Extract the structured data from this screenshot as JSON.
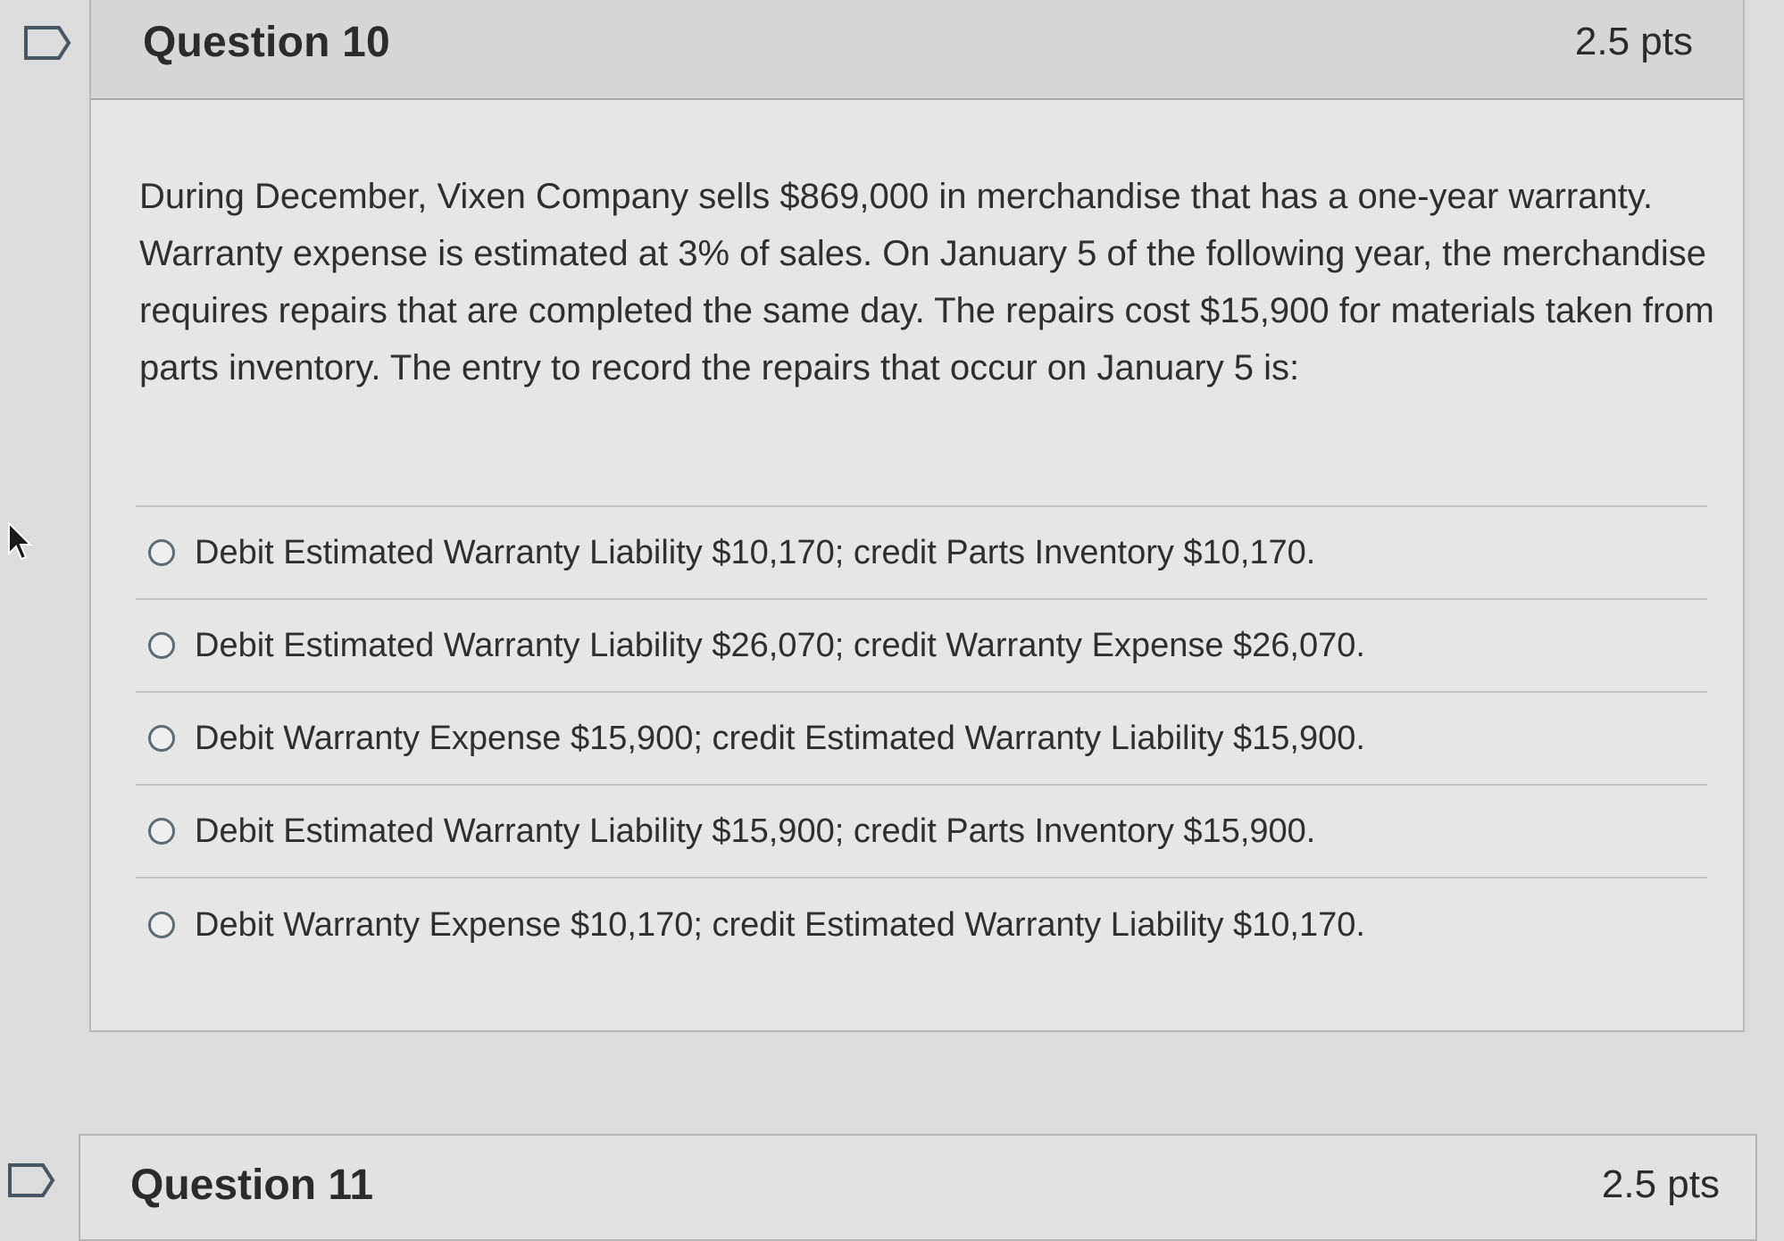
{
  "question": {
    "title": "Question 10",
    "points": "2.5 pts",
    "text": "During December, Vixen Company sells $869,000 in merchandise that has a one-year warranty. Warranty expense is estimated at 3% of sales. On January 5 of the following year, the merchandise requires repairs that are completed the same day. The repairs cost $15,900 for materials taken from parts inventory. The entry to record the repairs that occur on January 5 is:",
    "answers": [
      {
        "label": "Debit Estimated Warranty Liability $10,170; credit Parts Inventory $10,170."
      },
      {
        "label": "Debit Estimated Warranty Liability $26,070; credit Warranty Expense $26,070."
      },
      {
        "label": "Debit Warranty Expense $15,900; credit Estimated Warranty Liability $15,900."
      },
      {
        "label": "Debit Estimated Warranty Liability $15,900; credit Parts Inventory $15,900."
      },
      {
        "label": "Debit Warranty Expense $10,170; credit Estimated Warranty Liability $10,170."
      }
    ]
  },
  "next_question": {
    "title": "Question 11",
    "points": "2.5 pts"
  },
  "icons": {
    "flag": "flag-question-icon",
    "cursor": "mouse-pointer-icon"
  }
}
